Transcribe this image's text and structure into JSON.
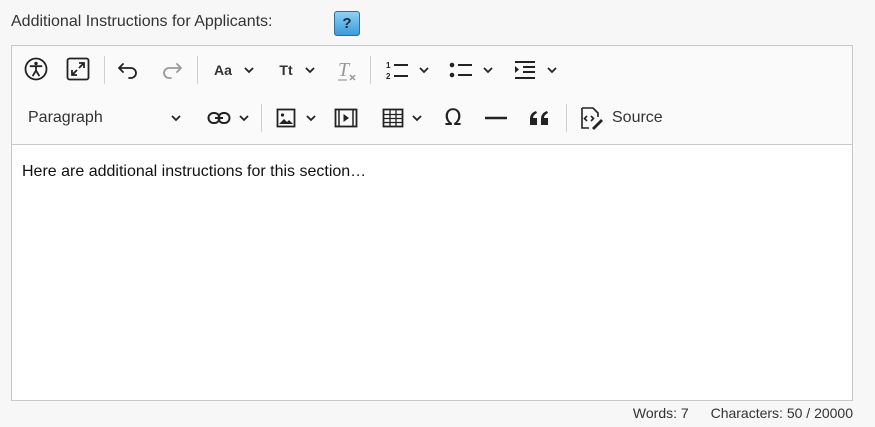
{
  "field": {
    "label": "Additional Instructions for Applicants:",
    "help_label": "?"
  },
  "toolbar": {
    "font_size_label": "Aa",
    "text_size_label": "Tt",
    "block_format": "Paragraph",
    "source_label": "Source",
    "icons": [
      "accessibility-icon",
      "fullscreen-icon",
      "undo-icon",
      "redo-icon",
      "font-family-icon",
      "font-size-icon",
      "remove-format-icon",
      "numbered-list-icon",
      "bulleted-list-icon",
      "indent-icon",
      "link-icon",
      "image-icon",
      "media-icon",
      "table-icon",
      "special-characters-icon",
      "horizontal-line-icon",
      "blockquote-icon",
      "source-icon"
    ]
  },
  "editor": {
    "content": "Here are additional instructions for this section…"
  },
  "status": {
    "words": "Words: 7",
    "characters": "Characters: 50 / 20000"
  }
}
